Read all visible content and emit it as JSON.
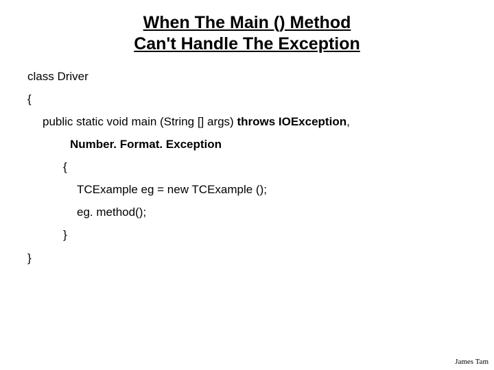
{
  "title_line1": "When The Main () Method",
  "title_line2": "Can't Handle The Exception",
  "code": {
    "l1": "class Driver",
    "l2": "{",
    "l3_a": "public static void main (String [] args) ",
    "l3_b": "throws IOException",
    "l3_c": ",",
    "l4": "Number. Format. Exception",
    "l5": "{",
    "l6": "TCExample eg = new TCExample ();",
    "l7": "eg. method();",
    "l8": "}",
    "l9": "}"
  },
  "footer": "James Tam"
}
